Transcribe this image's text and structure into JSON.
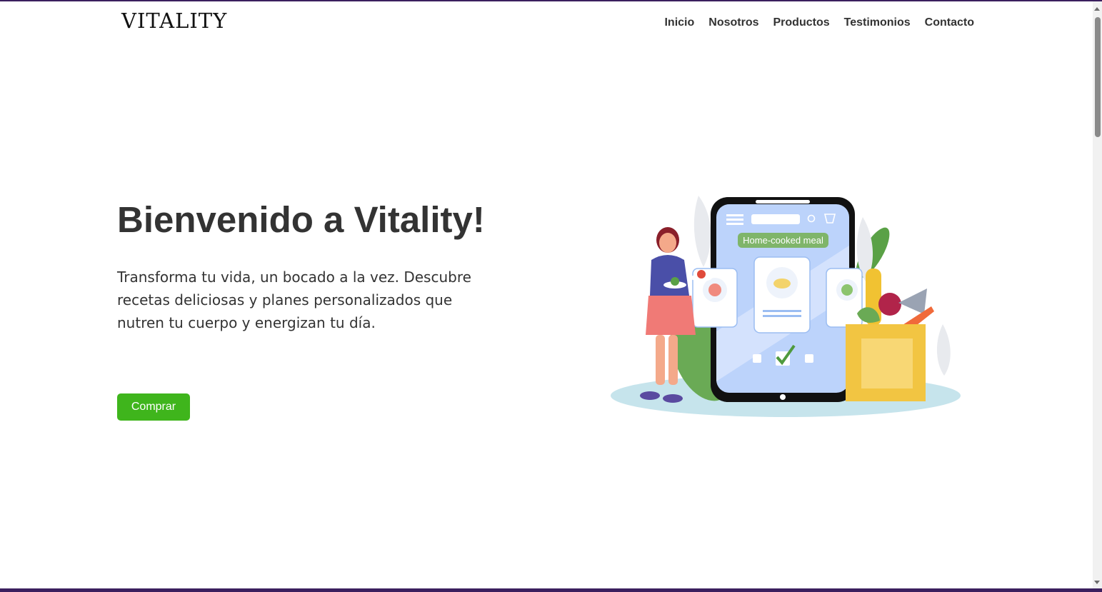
{
  "header": {
    "logo": "VITALITY",
    "nav": [
      {
        "label": "Inicio"
      },
      {
        "label": "Nosotros"
      },
      {
        "label": "Productos"
      },
      {
        "label": "Testimonios"
      },
      {
        "label": "Contacto"
      }
    ]
  },
  "hero": {
    "title": "Bienvenido a Vitality!",
    "text": "Transforma tu vida, un bocado a la vez. Descubre recetas deliciosas y planes personalizados que nutren tu cuerpo y energizan tu día.",
    "button_label": "Comprar",
    "illustration_label": "Home-cooked meal"
  },
  "colors": {
    "accent": "#3fb51c",
    "text": "#333333",
    "background": "#ffffff"
  }
}
